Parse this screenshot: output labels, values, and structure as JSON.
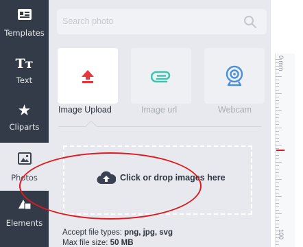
{
  "sidebar": {
    "items": [
      {
        "label": "Templates",
        "icon": "templates-icon"
      },
      {
        "label": "Text",
        "icon": "text-icon"
      },
      {
        "label": "Cliparts",
        "icon": "star-icon"
      },
      {
        "label": "Photos",
        "icon": "photo-icon",
        "active": true
      },
      {
        "label": "Elements",
        "icon": "shapes-icon"
      }
    ]
  },
  "search": {
    "placeholder": "Search photo"
  },
  "tabs": [
    {
      "label": "Image Upload",
      "active": true,
      "icon": "upload-arrow-icon"
    },
    {
      "label": "Image url",
      "icon": "paperclip-icon"
    },
    {
      "label": "Webcam",
      "icon": "webcam-icon"
    }
  ],
  "dropzone": {
    "label": "Click or drop images here"
  },
  "accept": {
    "label": "Accept file types:",
    "value": "png, jpg, svg"
  },
  "maxsize": {
    "label": "Max file size:",
    "value": "50 MB"
  },
  "ruler": {
    "top_label": "0 mm",
    "bottom_label": "100"
  },
  "colors": {
    "accent": "#e0191f",
    "sidebar": "#333b48",
    "upload_red": "#e8373b",
    "teal": "#3cc6b0",
    "blue": "#4a8fd9"
  }
}
